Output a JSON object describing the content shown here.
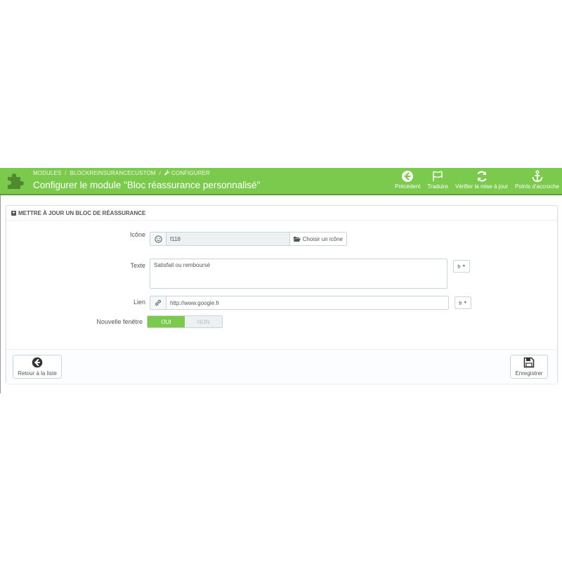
{
  "header": {
    "breadcrumb": [
      "MODULES",
      "BLOCKREINSURANCECUSTOM",
      "CONFIGURER"
    ],
    "title": "Configurer le module \"Bloc réassurance personnalisé\"",
    "accent_color": "#7bc94d",
    "toolbar": [
      {
        "label": "Précédent",
        "icon": "arrow-circle-left-icon"
      },
      {
        "label": "Traduire",
        "icon": "flag-icon"
      },
      {
        "label": "Vérifier la mise à jour",
        "icon": "refresh-icon"
      },
      {
        "label": "Points d'accroche",
        "icon": "anchor-icon"
      }
    ]
  },
  "panel": {
    "heading": "METTRE À JOUR UN BLOC DE RÉASSURANCE",
    "fields": {
      "icon": {
        "label": "Icône",
        "value": "f118",
        "choose_label": "Choisir un icône"
      },
      "text": {
        "label": "Texte",
        "value": "Satisfait ou remboursé",
        "lang": "fr"
      },
      "link": {
        "label": "Lien",
        "value": "http://www.google.fr",
        "lang": "fr"
      },
      "new_window": {
        "label": "Nouvelle fenêtre",
        "on_label": "OUI",
        "off_label": "NON",
        "selected": "OUI"
      }
    },
    "footer": {
      "back_label": "Retour à la liste",
      "save_label": "Enregistrer"
    }
  }
}
